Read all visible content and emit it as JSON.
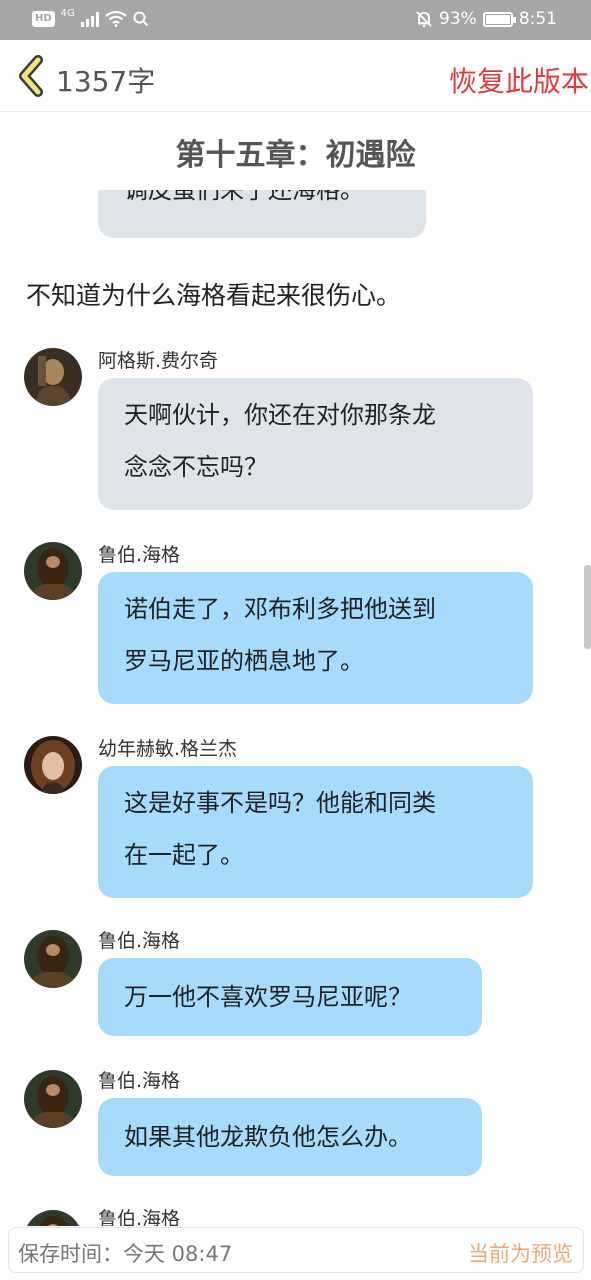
{
  "status_bar": {
    "hd": "HD",
    "network": "4G",
    "battery": "93%",
    "time": "8:51",
    "icons": [
      "hd-icon",
      "signal-icon",
      "wifi-icon",
      "search-icon",
      "bell-off-icon",
      "battery-icon"
    ]
  },
  "header": {
    "word_count": "1357字",
    "restore_label": "恢复此版本",
    "back_icon": "chevron-left-icon"
  },
  "chapter_title": "第十五章：初遇险",
  "content": {
    "partial_bubble": "调皮蛋们来了还海格。",
    "narration": "不知道为什么海格看起来很伤心。",
    "messages": [
      {
        "name": "阿格斯.费尔奇",
        "lines": [
          "天啊伙计，你还在对你那条龙",
          "念念不忘吗？"
        ],
        "color": "grey"
      },
      {
        "name": "鲁伯.海格",
        "lines": [
          "诺伯走了，邓布利多把他送到",
          "罗马尼亚的栖息地了。"
        ],
        "color": "blue"
      },
      {
        "name": "幼年赫敏.格兰杰",
        "lines": [
          "这是好事不是吗？他能和同类",
          "在一起了。"
        ],
        "color": "blue"
      },
      {
        "name": "鲁伯.海格",
        "lines": [
          "万一他不喜欢罗马尼亚呢？"
        ],
        "color": "blue"
      },
      {
        "name": "鲁伯.海格",
        "lines": [
          "如果其他龙欺负他怎么办。"
        ],
        "color": "blue"
      },
      {
        "name": "鲁伯.海格",
        "lines": [],
        "color": "blue"
      }
    ]
  },
  "footer": {
    "save_time": "保存时间：今天 08:47",
    "preview_label": "当前为预览"
  },
  "colors": {
    "accent_red": "#e03c3c",
    "bubble_grey": "#dfe3ea",
    "bubble_blue": "#a6dbfb",
    "preview_orange": "#f0a878"
  }
}
